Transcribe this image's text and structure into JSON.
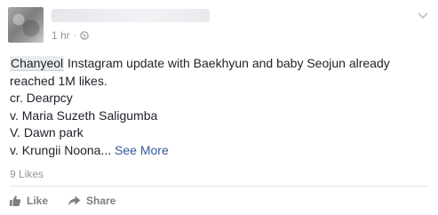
{
  "post": {
    "time": "1 hr",
    "separator": "·",
    "privacy_icon": "globe-icon",
    "tagged_name": "Chanyeol",
    "line1_rest": " Instagram update with Baekhyun and baby Seojun already",
    "line2": "reached 1M likes.",
    "line3": "cr. Dearpcy",
    "line4": "v. Maria Suzeth Saligumba",
    "line5": "V. Dawn park",
    "line6": "v. Krungii Noona...",
    "see_more": "See More"
  },
  "footer": {
    "likes": "9 Likes",
    "like_label": "Like",
    "share_label": "Share"
  }
}
